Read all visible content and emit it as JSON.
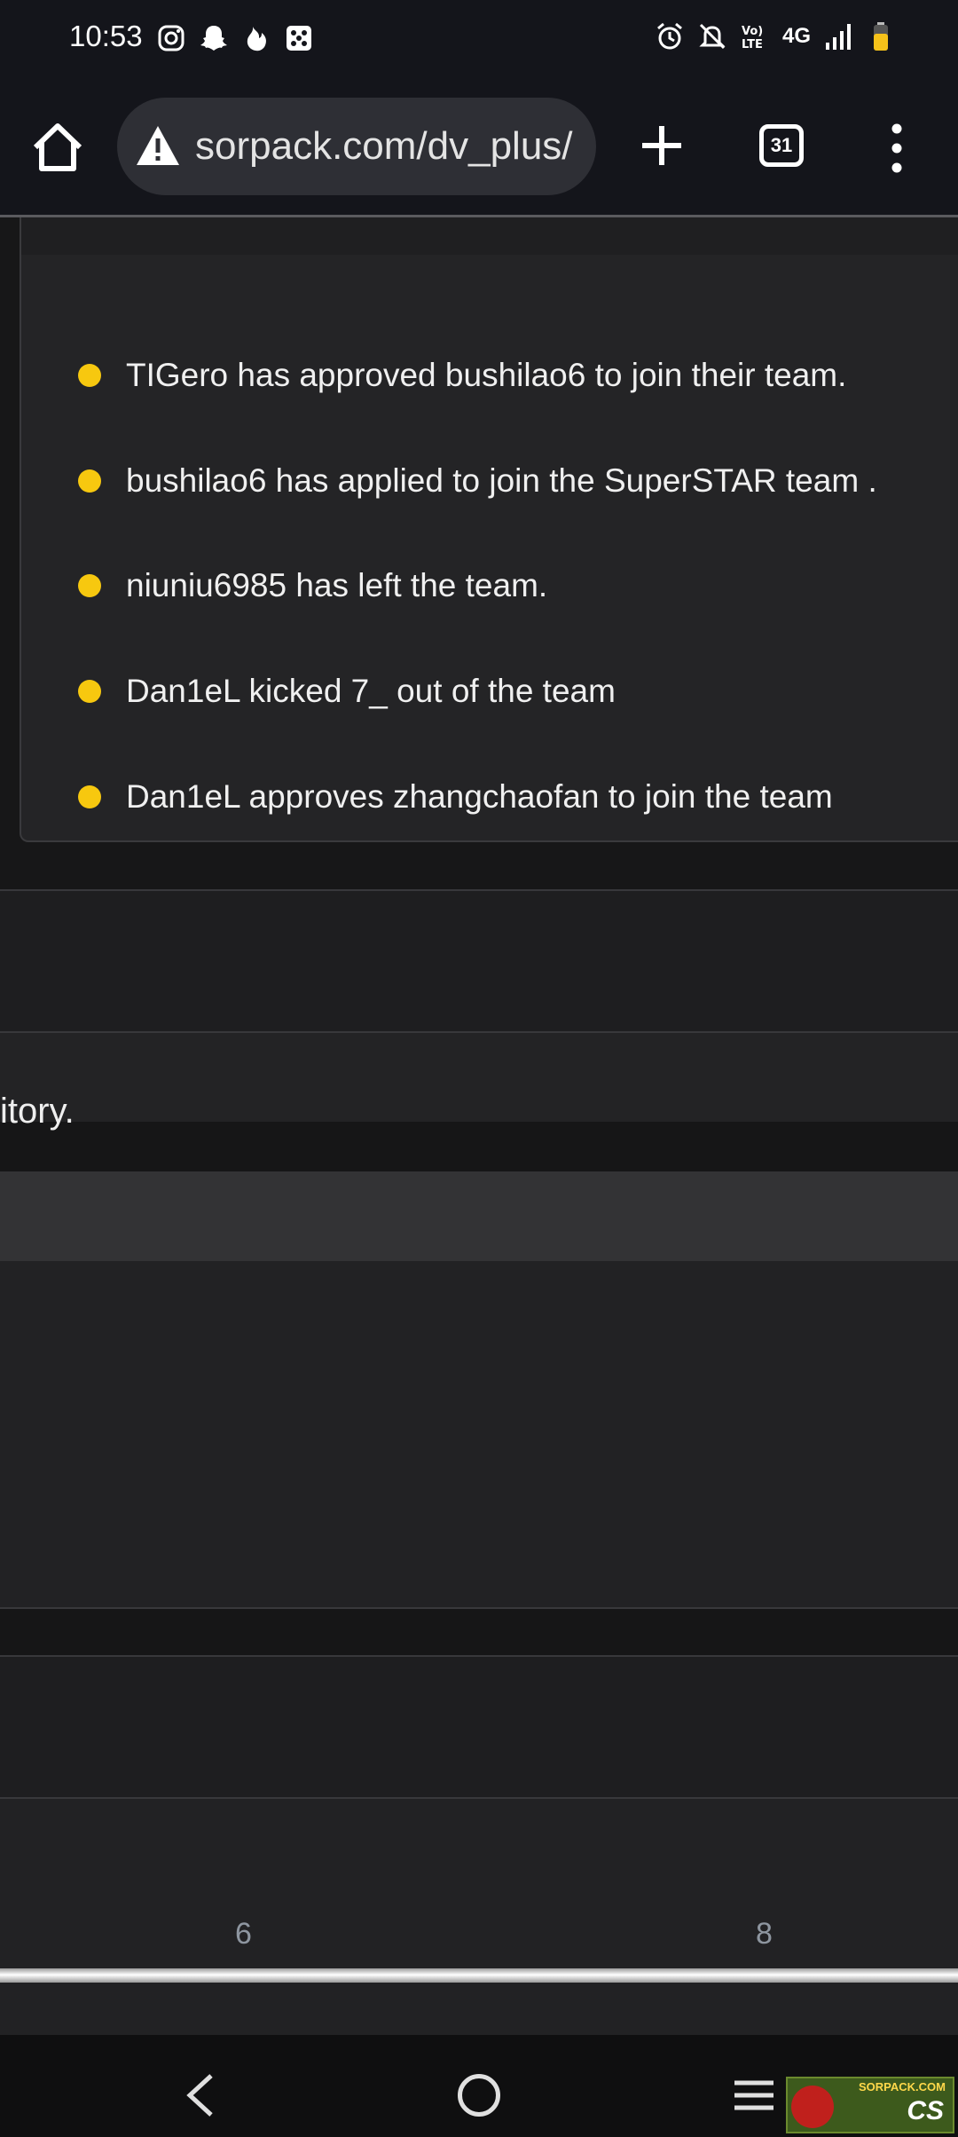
{
  "status_bar": {
    "time": "10:53",
    "network": "4G",
    "left_icons": [
      "instagram-icon",
      "snapchat-icon",
      "tinder-icon",
      "dice-icon"
    ],
    "right_icons": [
      "alarm-icon",
      "mute-icon",
      "volte-icon",
      "signal-icon",
      "battery-icon"
    ]
  },
  "browser": {
    "url": "sorpack.com/dv_plus/",
    "tab_count": "31",
    "url_warning_icon": "warning-icon"
  },
  "activity_feed": {
    "items": [
      {
        "text": "TIGero has approved bushilao6 to join their team."
      },
      {
        "text": "bushilao6 has applied to join the SuperSTAR team ."
      },
      {
        "text": "niuniu6985 has left the team."
      },
      {
        "text": "Dan1eL kicked 7_ out of the team"
      },
      {
        "text": "Dan1eL approves zhangchaofan to join the team"
      }
    ],
    "bullet_color": "#f7c80f"
  },
  "partial_text": "itory.",
  "slider": {
    "tick_labels": [
      "6",
      "8"
    ]
  },
  "watermark": {
    "top_text": "SORPACK.COM",
    "main_text": "CS"
  }
}
